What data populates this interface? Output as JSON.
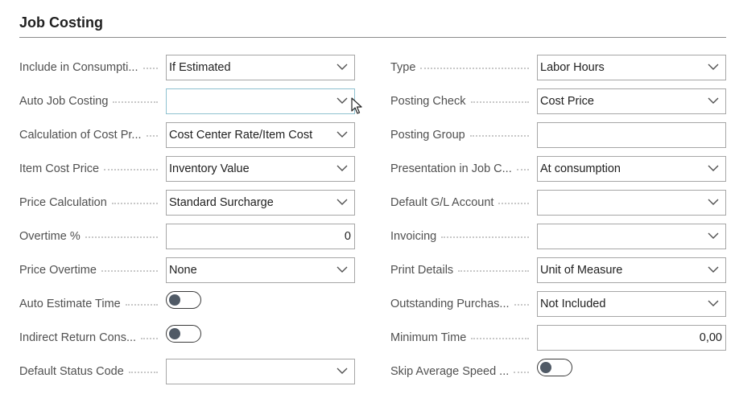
{
  "section": {
    "title": "Job Costing"
  },
  "left_fields": [
    {
      "label": "Include in Consumpti...",
      "type": "select",
      "value": "If Estimated"
    },
    {
      "label": "Auto Job Costing",
      "type": "select",
      "value": "",
      "focused": true
    },
    {
      "label": "Calculation of Cost Pr...",
      "type": "select",
      "value": "Cost Center Rate/Item Cost"
    },
    {
      "label": "Item Cost Price",
      "type": "select",
      "value": "Inventory Value"
    },
    {
      "label": "Price Calculation",
      "type": "select",
      "value": "Standard Surcharge"
    },
    {
      "label": "Overtime %",
      "type": "number",
      "value": "0"
    },
    {
      "label": "Price Overtime",
      "type": "select",
      "value": "None"
    },
    {
      "label": "Auto Estimate Time",
      "type": "toggle",
      "value": "off"
    },
    {
      "label": "Indirect Return Cons...",
      "type": "toggle",
      "value": "off"
    },
    {
      "label": "Default Status Code",
      "type": "select",
      "value": ""
    }
  ],
  "right_fields": [
    {
      "label": "Type",
      "type": "select",
      "value": "Labor Hours"
    },
    {
      "label": "Posting Check",
      "type": "select",
      "value": "Cost Price"
    },
    {
      "label": "Posting Group",
      "type": "text",
      "value": ""
    },
    {
      "label": "Presentation in Job C...",
      "type": "select",
      "value": "At consumption"
    },
    {
      "label": "Default G/L Account",
      "type": "select",
      "value": ""
    },
    {
      "label": "Invoicing",
      "type": "select",
      "value": ""
    },
    {
      "label": "Print Details",
      "type": "select",
      "value": "Unit of Measure"
    },
    {
      "label": "Outstanding Purchas...",
      "type": "select",
      "value": "Not Included"
    },
    {
      "label": "Minimum Time",
      "type": "number",
      "value": "0,00"
    },
    {
      "label": "Skip Average Speed ...",
      "type": "toggle",
      "value": "off"
    }
  ],
  "icons": {
    "dropdown": "chevron-down-icon",
    "pointer": "mouse-pointer-icon"
  },
  "colors": {
    "title": "#212121",
    "label": "#505050",
    "border": "#a6a6a6",
    "focus_border": "#8ec1d0",
    "toggle_knob": "#505a66"
  }
}
